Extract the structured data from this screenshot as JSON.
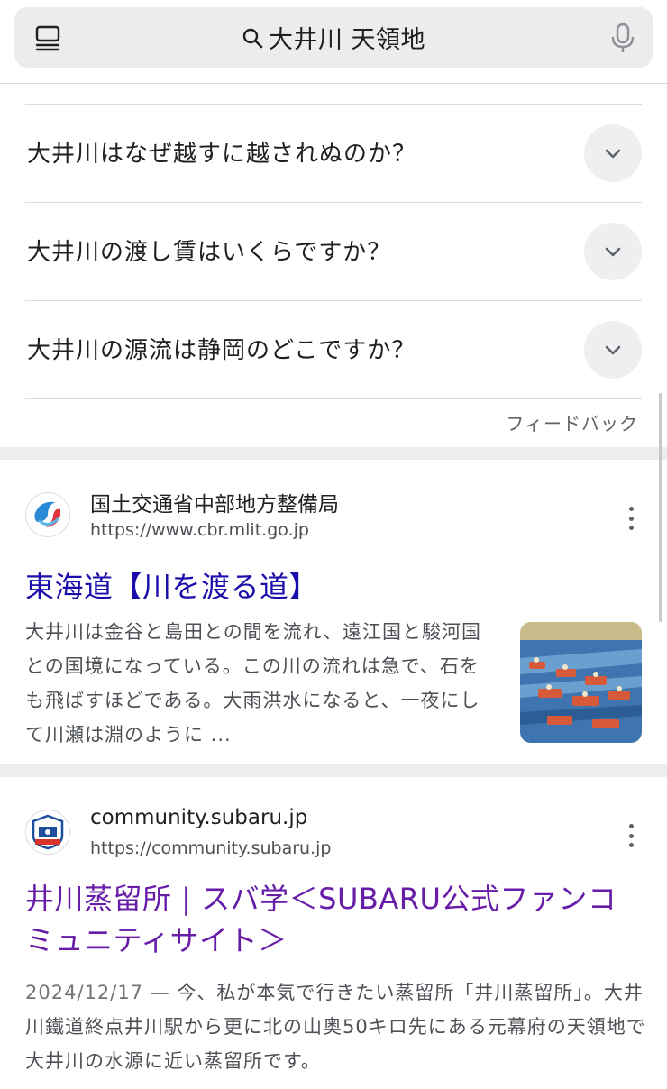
{
  "search": {
    "query": "大井川 天領地"
  },
  "faq": {
    "items": [
      {
        "question": "大井川はなぜ越すに越されぬのか？"
      },
      {
        "question": "大井川の渡し賃はいくらですか？"
      },
      {
        "question": "大井川の源流は静岡のどこですか？"
      }
    ],
    "feedback_label": "フィードバック"
  },
  "results": [
    {
      "site_name": "国土交通省中部地方整備局",
      "url": "https://www.cbr.mlit.go.jp",
      "title": "東海道【川を渡る道】",
      "snippet": "大井川は金谷と島田との間を流れ、遠江国と駿河国との国境になっている。この川の流れは急で、石をも飛ばすほどである。大雨洪水になると、一夜にして川瀬は淵のように ..."
    },
    {
      "site_name": "community.subaru.jp",
      "url": "https://community.subaru.jp",
      "title": "井川蒸留所 | スバ学＜SUBARU公式ファンコミュニティサイト＞",
      "date": "2024/12/17",
      "date_separator": " — ",
      "snippet": "今、私が本気で行きたい蒸留所「井川蒸留所」。大井川鐵道終点井川駅から更に北の山奥50キロ先にある元幕府の天領地で大井川の水源に近い蒸留所です。"
    }
  ],
  "colors": {
    "link_blue": "#1a0dab",
    "link_visited": "#681da8",
    "searchbar_bg": "#ececee"
  },
  "icons": [
    "menu-icon",
    "search-icon",
    "mic-icon",
    "chevron-down-icon",
    "more-vert-icon"
  ]
}
